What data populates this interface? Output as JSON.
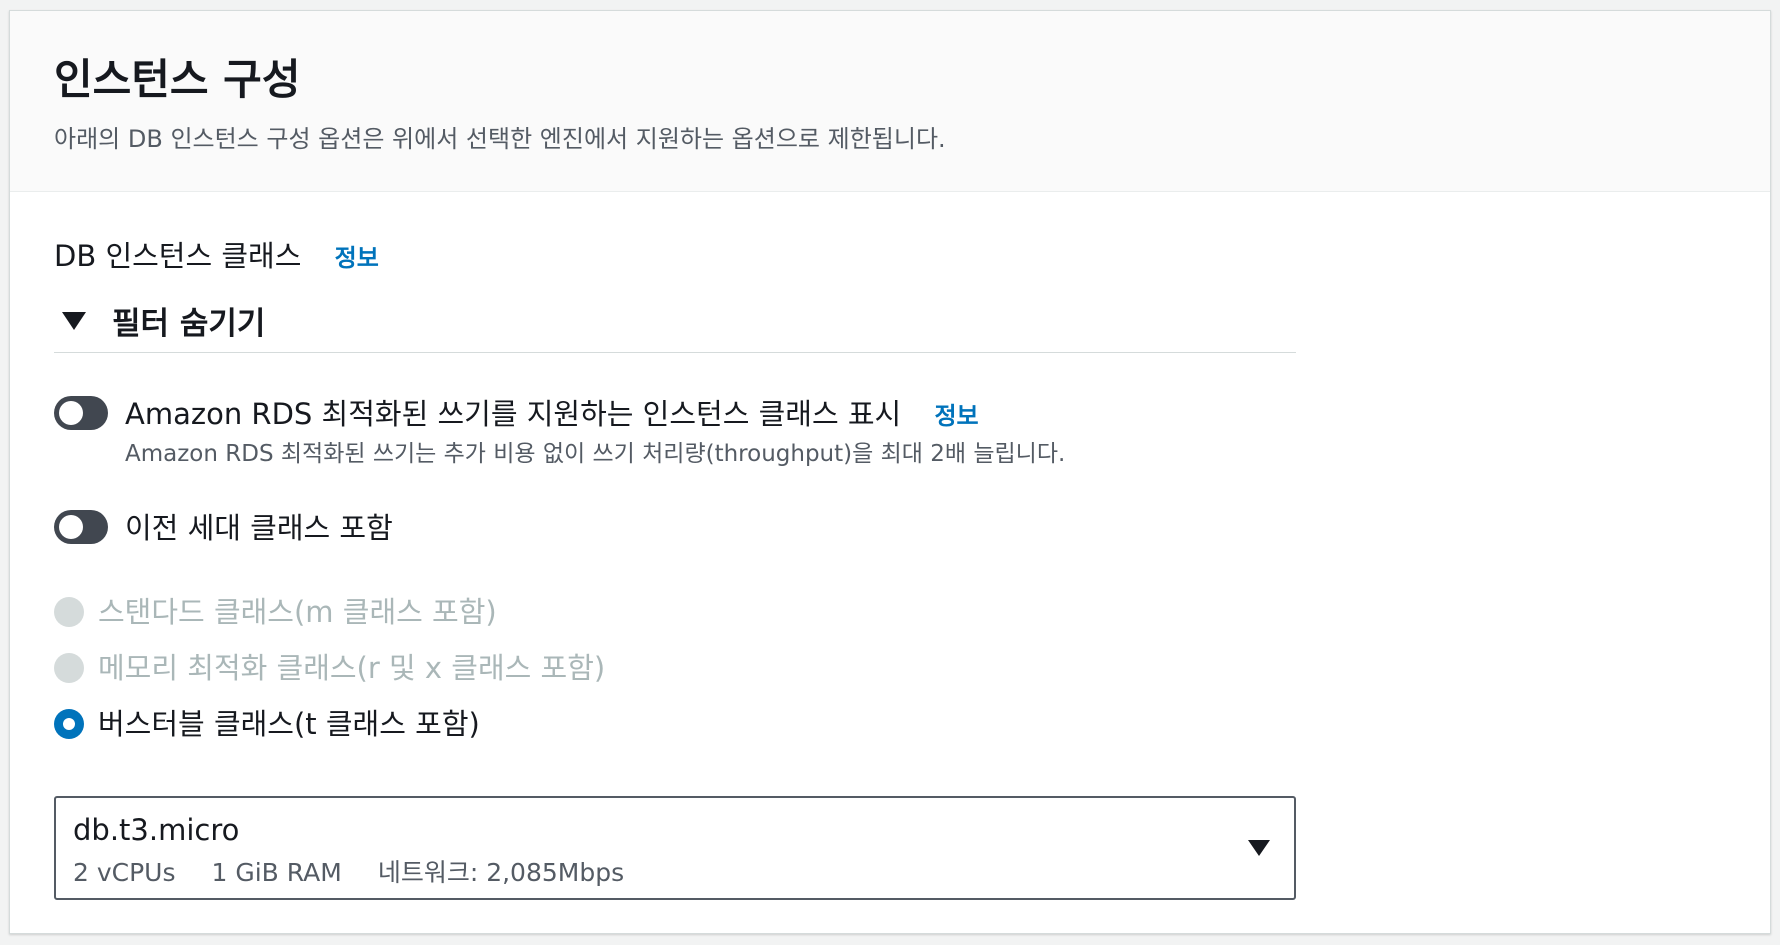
{
  "panel": {
    "title": "인스턴스 구성",
    "description": "아래의 DB 인스턴스 구성 옵션은 위에서 선택한 엔진에서 지원하는 옵션으로 제한됩니다."
  },
  "instance_class": {
    "label": "DB 인스턴스 클래스",
    "info_link": "정보",
    "filter_toggle_label": "필터 숨기기"
  },
  "toggles": [
    {
      "label": "Amazon RDS 최적화된 쓰기를 지원하는 인스턴스 클래스 표시",
      "info_link": "정보",
      "description": "Amazon RDS 최적화된 쓰기는 추가 비용 없이 쓰기 처리량(throughput)을 최대 2배 늘립니다.",
      "state": "off"
    },
    {
      "label": "이전 세대 클래스 포함",
      "state": "off"
    }
  ],
  "class_options": [
    {
      "label": "스탠다드 클래스(m 클래스 포함)",
      "state": "disabled"
    },
    {
      "label": "메모리 최적화 클래스(r 및 x 클래스 포함)",
      "state": "disabled"
    },
    {
      "label": "버스터블 클래스(t 클래스 포함)",
      "state": "selected"
    }
  ],
  "instance_select": {
    "value": "db.t3.micro",
    "vcpus": "2 vCPUs",
    "ram": "1 GiB RAM",
    "network": "네트워크: 2,085Mbps"
  },
  "colors": {
    "link": "#0073bb",
    "toggle_off": "#414750",
    "radio_selected": "#0073bb",
    "radio_disabled": "#d5dbdb",
    "text_disabled": "#aab7b8"
  }
}
